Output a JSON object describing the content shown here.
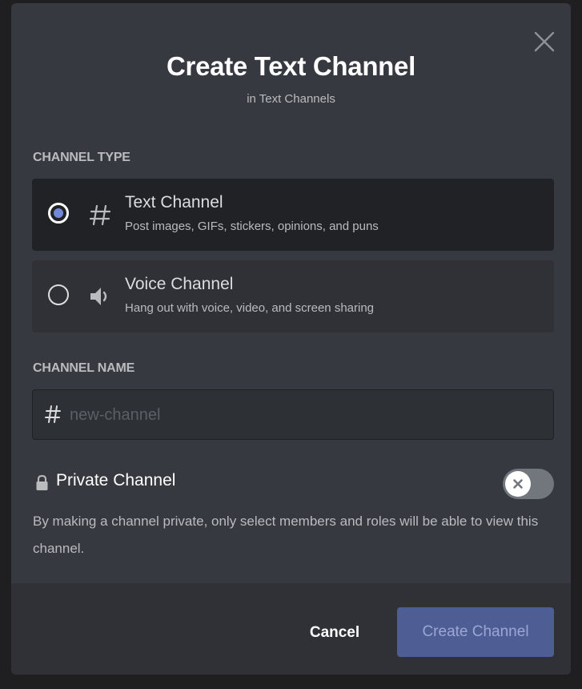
{
  "modal": {
    "title": "Create Text Channel",
    "subtitle": "in Text Channels"
  },
  "channel_type": {
    "label": "CHANNEL TYPE",
    "options": [
      {
        "name": "Text Channel",
        "description": "Post images, GIFs, stickers, opinions, and puns",
        "icon": "hash-icon",
        "selected": true
      },
      {
        "name": "Voice Channel",
        "description": "Hang out with voice, video, and screen sharing",
        "icon": "speaker-icon",
        "selected": false
      }
    ]
  },
  "channel_name": {
    "label": "CHANNEL NAME",
    "value": "",
    "placeholder": "new-channel",
    "prefix_icon": "hash-icon"
  },
  "private_channel": {
    "label": "Private Channel",
    "icon": "lock-icon",
    "enabled": false,
    "description": "By making a channel private, only select members and roles will be able to view this channel."
  },
  "footer": {
    "cancel_label": "Cancel",
    "create_label": "Create Channel"
  },
  "colors": {
    "accent": "#7289da",
    "modal_bg": "#36393f",
    "footer_bg": "#2f3136",
    "selected_option_bg": "#202225",
    "disabled_button_bg": "#4e5d94"
  }
}
